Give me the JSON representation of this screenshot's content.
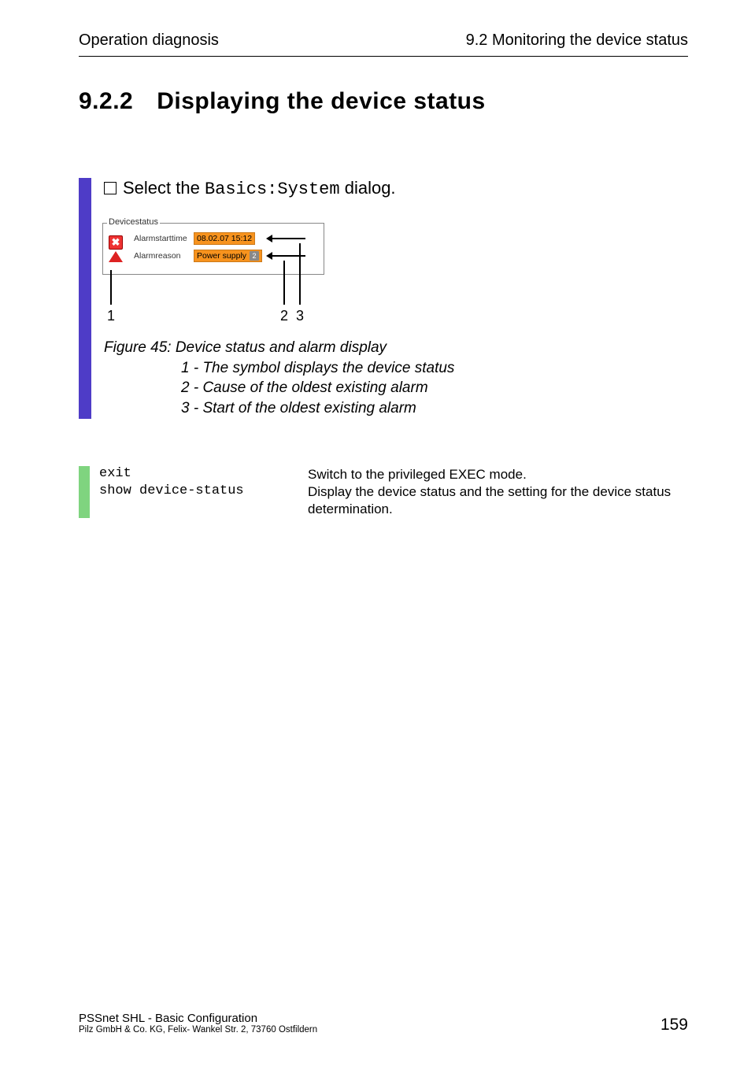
{
  "header": {
    "left": "Operation diagnosis",
    "right": "9.2  Monitoring the device status"
  },
  "heading": {
    "number": "9.2.2",
    "title": "Displaying the device status"
  },
  "select_line": {
    "pre": "Select the ",
    "code": "Basics:System",
    "post": " dialog."
  },
  "devicestatus": {
    "legend": "Devicestatus",
    "row1_label": "Alarmstarttime",
    "row1_value": "08.02.07 15:12",
    "row2_label": "Alarmreason",
    "row2_value": "Power supply",
    "row2_badge": "2"
  },
  "callout_labels": {
    "n1": "1",
    "n2": "2",
    "n3": "3"
  },
  "caption": {
    "line0": "Figure 45: Device status and alarm display",
    "line1": "1 - The symbol displays the device status",
    "line2": "2 - Cause of the oldest existing alarm",
    "line3": "3 - Start of the oldest existing alarm"
  },
  "commands": {
    "r1": {
      "cmd": "exit",
      "desc": "Switch to the privileged EXEC mode."
    },
    "r2": {
      "cmd": "show device-status",
      "desc": "Display the device status and the setting for the device status determination."
    }
  },
  "footer": {
    "line1": "PSSnet SHL - Basic Configuration",
    "line2": "Pilz GmbH & Co. KG, Felix- Wankel Str. 2, 73760 Ostfildern",
    "pagenum": "159"
  }
}
